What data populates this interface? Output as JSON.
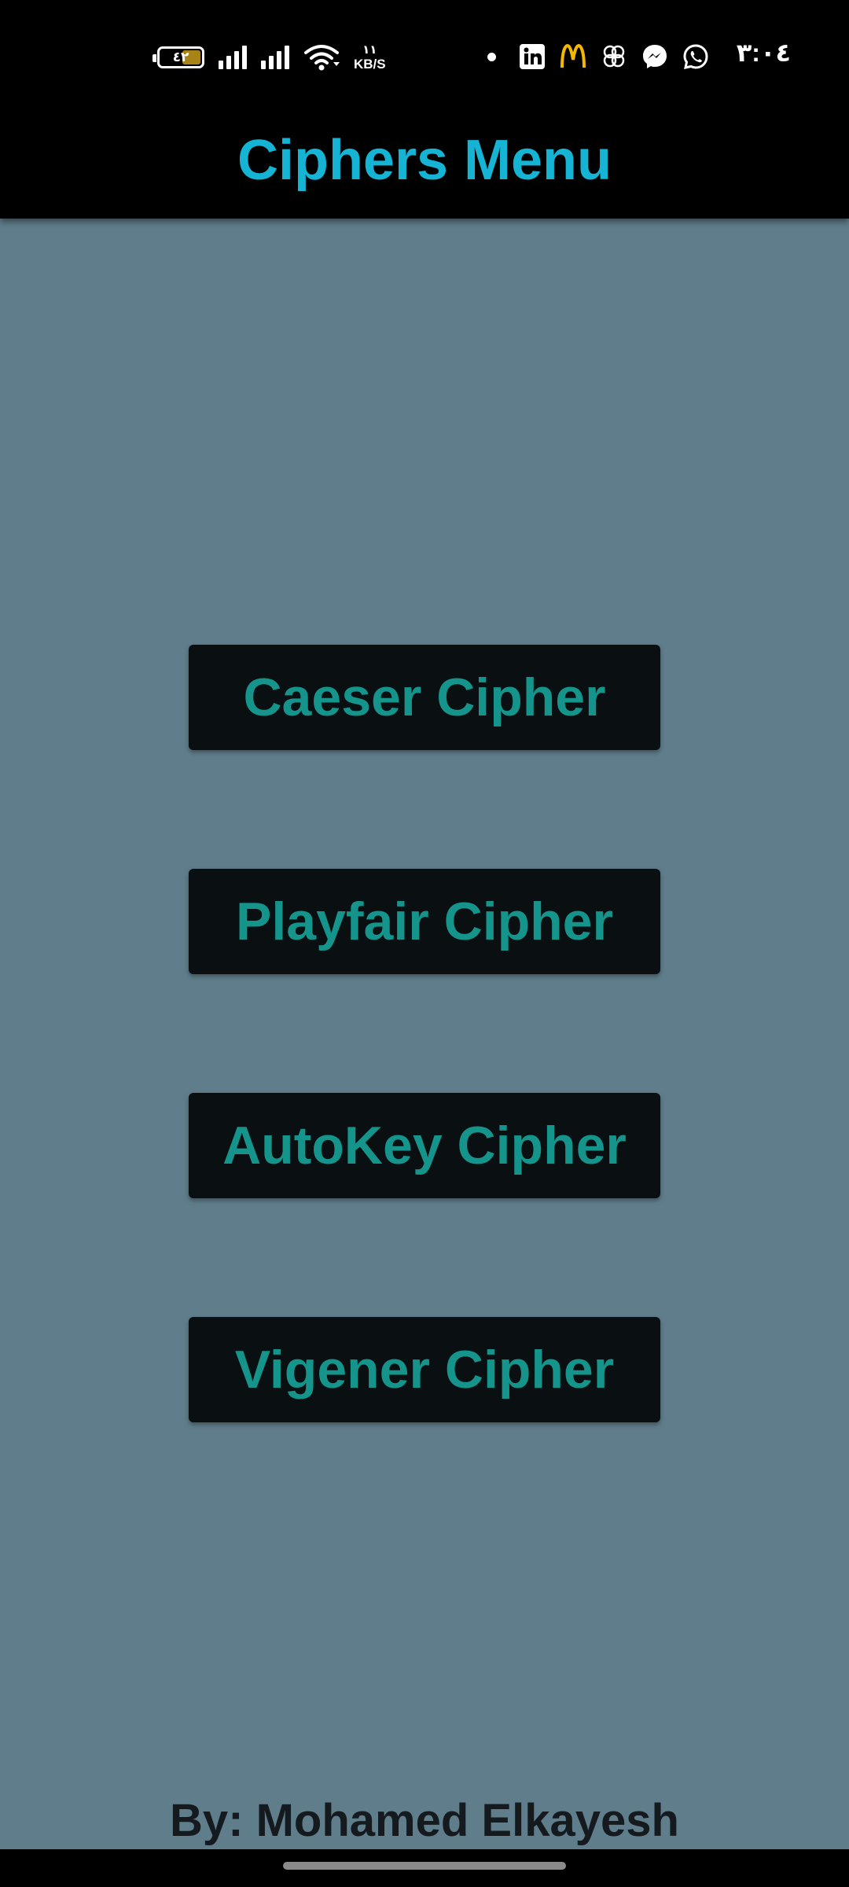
{
  "status_bar": {
    "battery_level": "٤٢",
    "battery_fraction": 0.42,
    "battery_color": "#a88416",
    "net_speed_value": "١١",
    "net_speed_unit": "KB/S",
    "time": "٣:٠٤",
    "notification_icons": [
      "linkedin-icon",
      "mcdonalds-icon",
      "clover-icon",
      "messenger-icon",
      "whatsapp-icon"
    ]
  },
  "app_bar": {
    "title": "Ciphers Menu",
    "title_color": "#15b3d4",
    "background": "#000000"
  },
  "menu": {
    "buttons": [
      {
        "label": "Caeser Cipher"
      },
      {
        "label": "Playfair Cipher"
      },
      {
        "label": "AutoKey Cipher"
      },
      {
        "label": "Vigener Cipher"
      }
    ],
    "button_text_color": "#14948a",
    "button_background": "#0a0f11"
  },
  "footer": {
    "author": "By: Mohamed Elkayesh"
  },
  "screen_background": "#607d8b"
}
